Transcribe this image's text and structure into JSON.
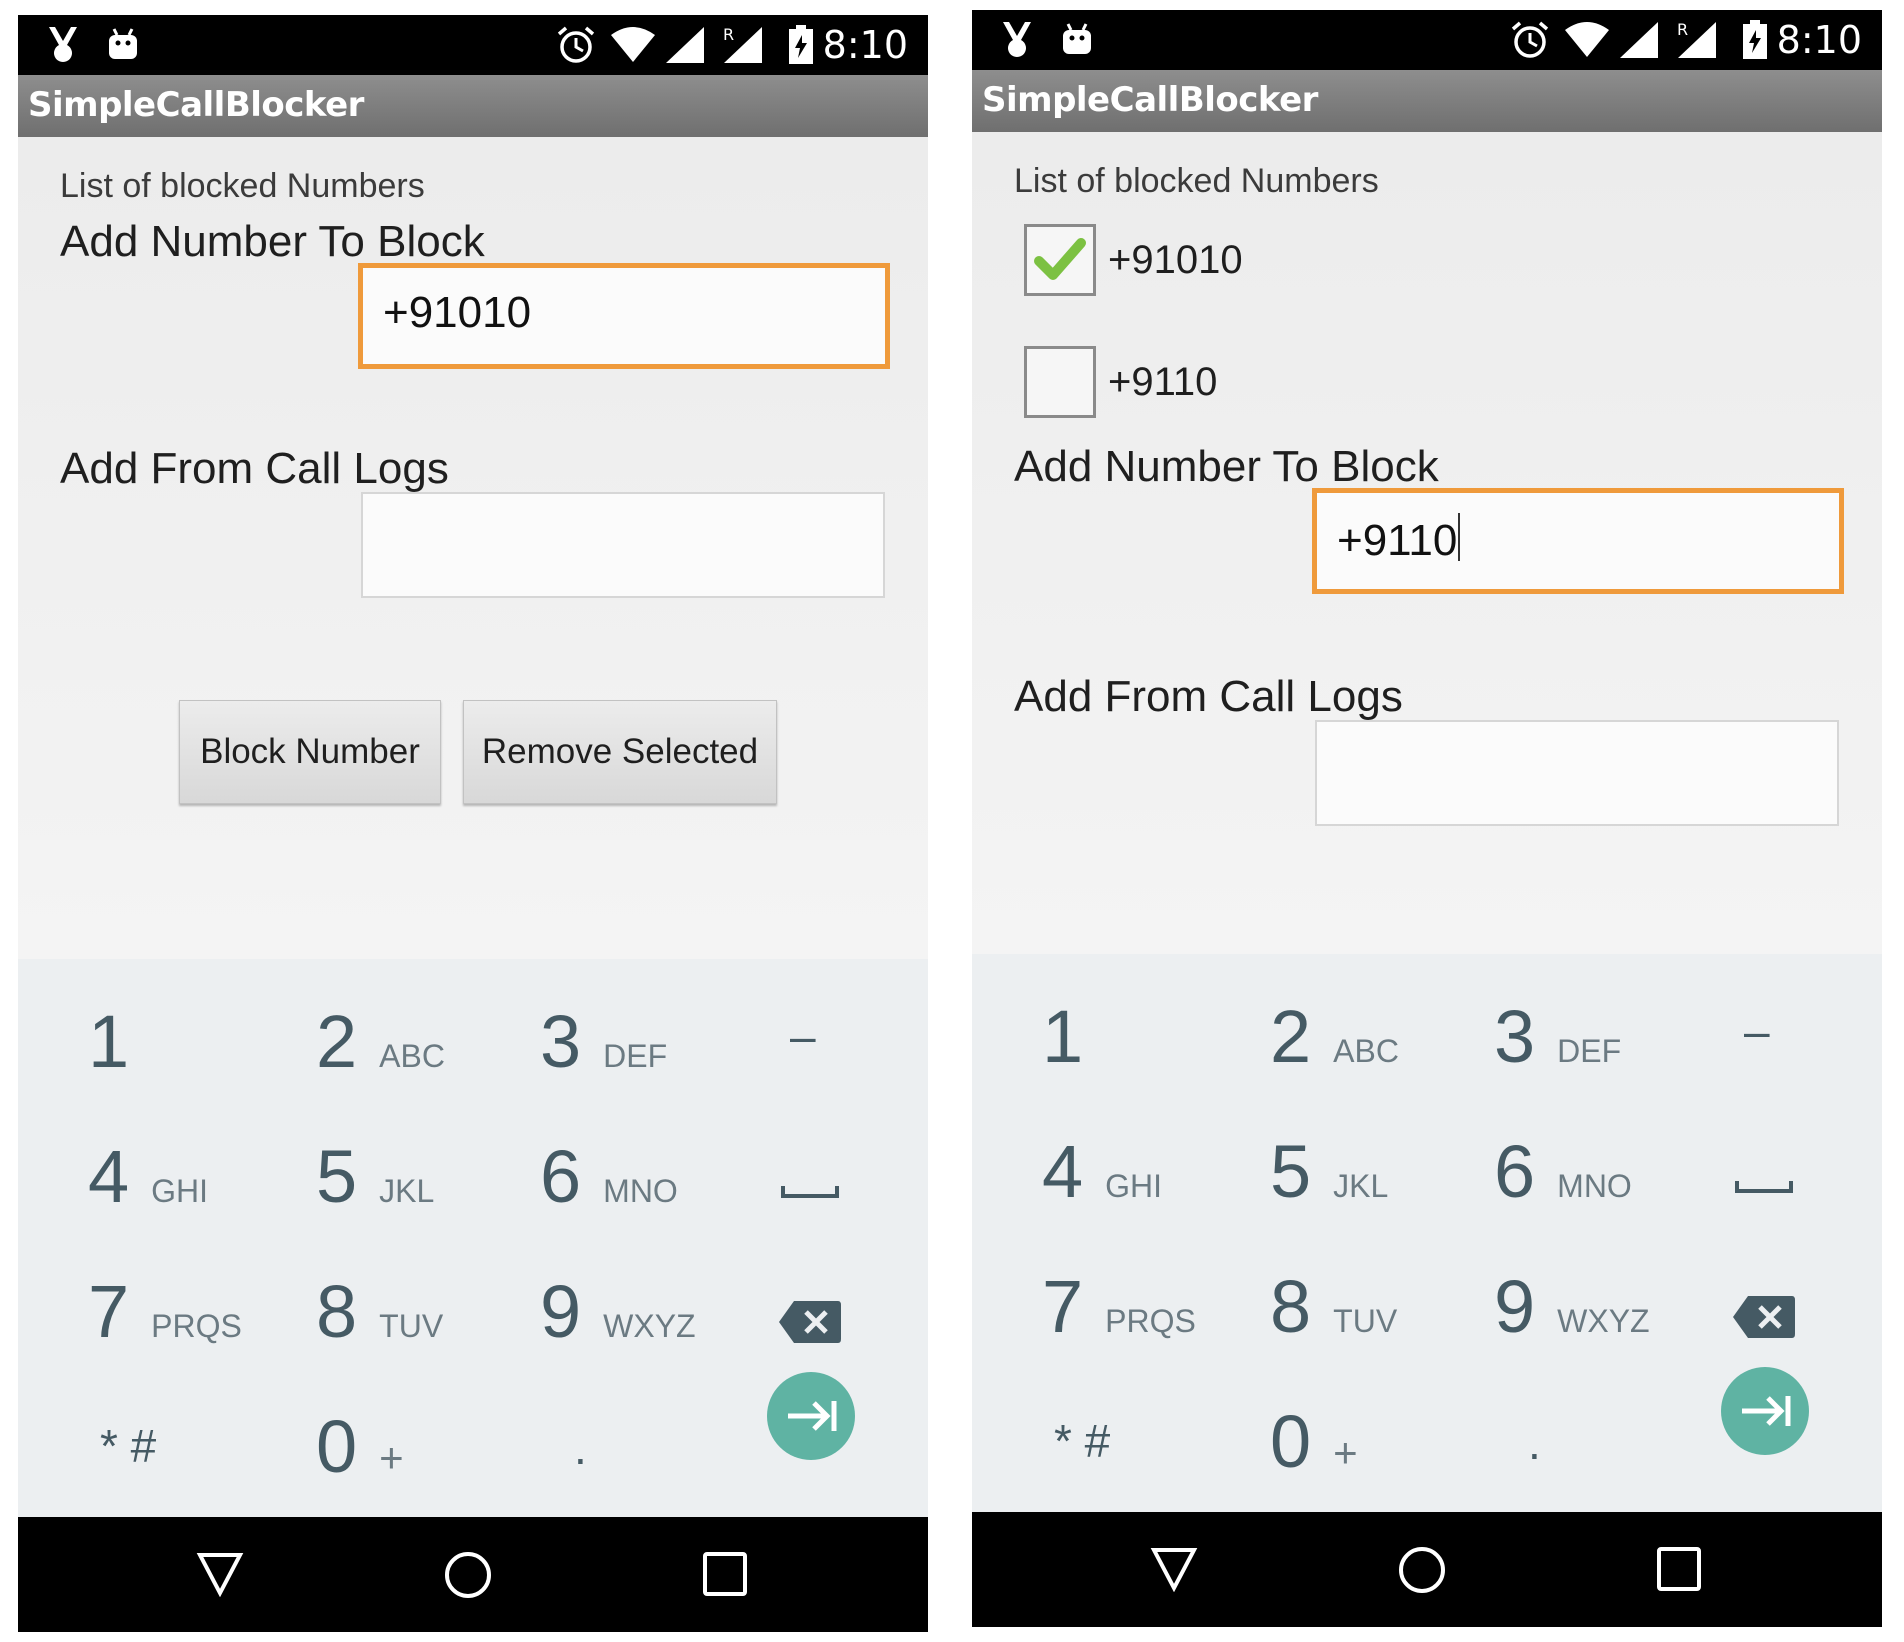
{
  "status_bar": {
    "time": "8:10",
    "icons": [
      "bug-icon",
      "android-icon",
      "alarm-icon",
      "wifi-icon",
      "signal-icon",
      "roaming-signal-icon",
      "battery-icon"
    ],
    "roaming_label": "R"
  },
  "app": {
    "title": "SimpleCallBlocker"
  },
  "screens": [
    {
      "list_label": "List of blocked Numbers",
      "blocked": [],
      "add_label": "Add Number To Block",
      "number_value": "+91010",
      "call_logs_label": "Add From Call Logs",
      "call_logs_value": "",
      "block_button": "Block Number",
      "remove_button": "Remove Selected"
    },
    {
      "list_label": "List of blocked Numbers",
      "blocked": [
        {
          "number": "+91010",
          "checked": true
        },
        {
          "number": "+9110",
          "checked": false
        }
      ],
      "add_label": "Add Number To Block",
      "number_value": "+9110",
      "call_logs_label": "Add From Call Logs",
      "call_logs_value": ""
    }
  ],
  "keypad": {
    "keys": [
      {
        "digit": "1",
        "letters": ""
      },
      {
        "digit": "2",
        "letters": "ABC"
      },
      {
        "digit": "3",
        "letters": "DEF"
      },
      {
        "digit": "–",
        "letters": ""
      },
      {
        "digit": "4",
        "letters": "GHI"
      },
      {
        "digit": "5",
        "letters": "JKL"
      },
      {
        "digit": "6",
        "letters": "MNO"
      },
      {
        "digit": "",
        "letters": "",
        "icon": "space-icon"
      },
      {
        "digit": "7",
        "letters": "PRQS"
      },
      {
        "digit": "8",
        "letters": "TUV"
      },
      {
        "digit": "9",
        "letters": "WXYZ"
      },
      {
        "digit": "",
        "letters": "",
        "icon": "backspace-icon"
      },
      {
        "digit": "* #",
        "letters": ""
      },
      {
        "digit": "0",
        "letters": "+"
      },
      {
        "digit": ".",
        "letters": ""
      },
      {
        "digit": "",
        "letters": "",
        "icon": "next-field-icon"
      }
    ],
    "accent": "#5fb3a3"
  },
  "nav_bar": {
    "icons": [
      "back-icon",
      "home-icon",
      "recents-icon"
    ]
  },
  "colors": {
    "focus_border": "#ef9a3b",
    "check_mark": "#7cc142"
  }
}
